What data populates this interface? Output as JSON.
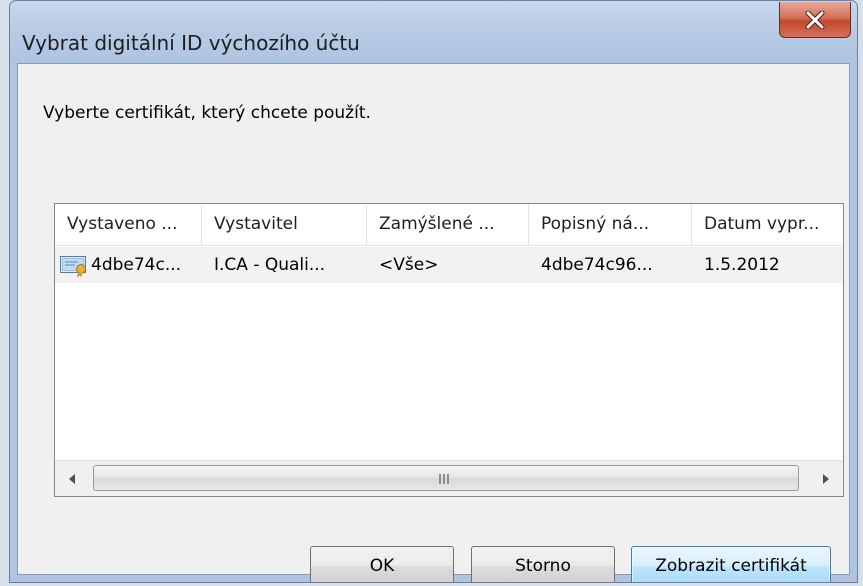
{
  "window": {
    "title": "Vybrat digitální ID výchozího účtu",
    "close_icon": "close-icon"
  },
  "prompt": "Vyberte certifikát, který chcete použít.",
  "table": {
    "columns": [
      "Vystaveno ...",
      "Vystavitel",
      "Zamýšlené ...",
      "Popisný ná...",
      "Datum vypr..."
    ],
    "rows": [
      {
        "icon": "certificate-icon",
        "issued_to": "4dbe74c...",
        "issuer": "I.CA - Quali...",
        "purpose": "<Vše>",
        "friendly_name": "4dbe74c96...",
        "expiry": "1.5.2012"
      }
    ]
  },
  "buttons": {
    "ok": "OK",
    "cancel": "Storno",
    "view_certificate": "Zobrazit certifikát"
  },
  "colors": {
    "close_button": "#c24a2f",
    "default_button_border": "#3c7fb1",
    "selected_row": "#f2f2f2"
  }
}
